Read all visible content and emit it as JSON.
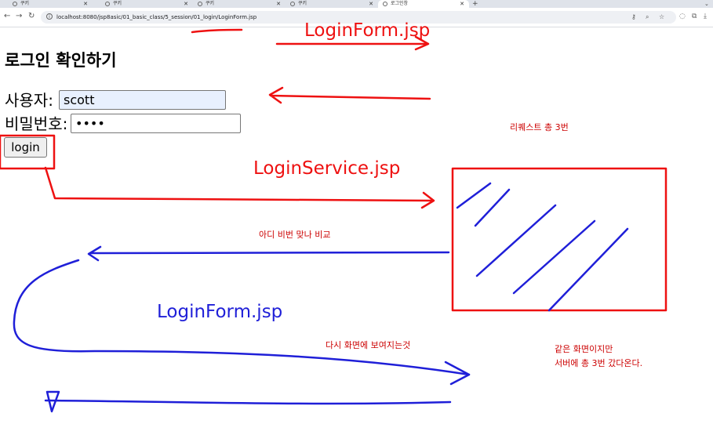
{
  "browser": {
    "tabs": [
      {
        "title": "쿠키",
        "active": false
      },
      {
        "title": "쿠키",
        "active": false
      },
      {
        "title": "쿠키",
        "active": false
      },
      {
        "title": "쿠키",
        "active": false
      },
      {
        "title": "로그인창",
        "active": true
      }
    ],
    "new_tab": "+",
    "url": "localhost:8080/jsp8asic/01_basic_class/5_session/01_login/LoginForm.jsp"
  },
  "page": {
    "title": "로그인 확인하기",
    "username_label": "사용자:",
    "username_value": "scott",
    "password_label": "비밀번호:",
    "password_value": "••••",
    "login_button": "login"
  },
  "annotations": {
    "colors": {
      "red": "#ee1111",
      "blue": "#1f1fd8"
    },
    "login_form_top": "LoginForm.jsp",
    "login_service": "LoginService.jsp",
    "login_form_blue": "LoginForm.jsp",
    "requests_note": "리퀘스트 총 3번",
    "compare_note": "아디 비번 맞나 비교",
    "redisplay_note": "다시 화면에 보여지는것",
    "same_screen_line1": "같은 화면이지만",
    "same_screen_line2": "서버에 총 3번 갔다온다."
  }
}
